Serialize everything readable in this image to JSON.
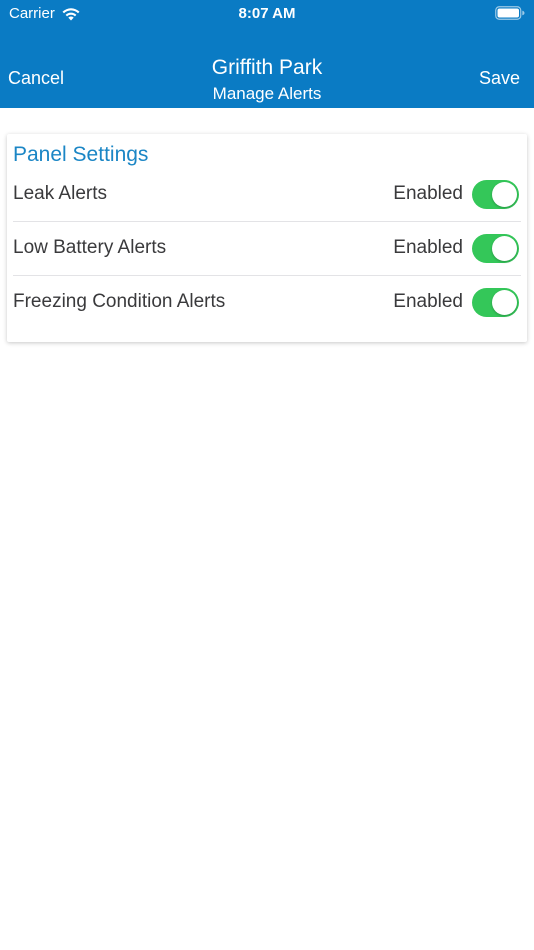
{
  "status_bar": {
    "carrier": "Carrier",
    "time": "8:07 AM",
    "icons": [
      "wifi-icon",
      "battery-icon"
    ]
  },
  "nav": {
    "title": "Griffith Park",
    "subtitle": "Manage Alerts",
    "cancel_label": "Cancel",
    "save_label": "Save"
  },
  "panel": {
    "title": "Panel Settings",
    "rows": [
      {
        "label": "Leak Alerts",
        "status": "Enabled",
        "on": true
      },
      {
        "label": "Low Battery Alerts",
        "status": "Enabled",
        "on": true
      },
      {
        "label": "Freezing Condition Alerts",
        "status": "Enabled",
        "on": true
      }
    ]
  },
  "colors": {
    "header": "#0a7bc4",
    "panel_title": "#1b86c5",
    "toggle_on": "#34c759"
  }
}
